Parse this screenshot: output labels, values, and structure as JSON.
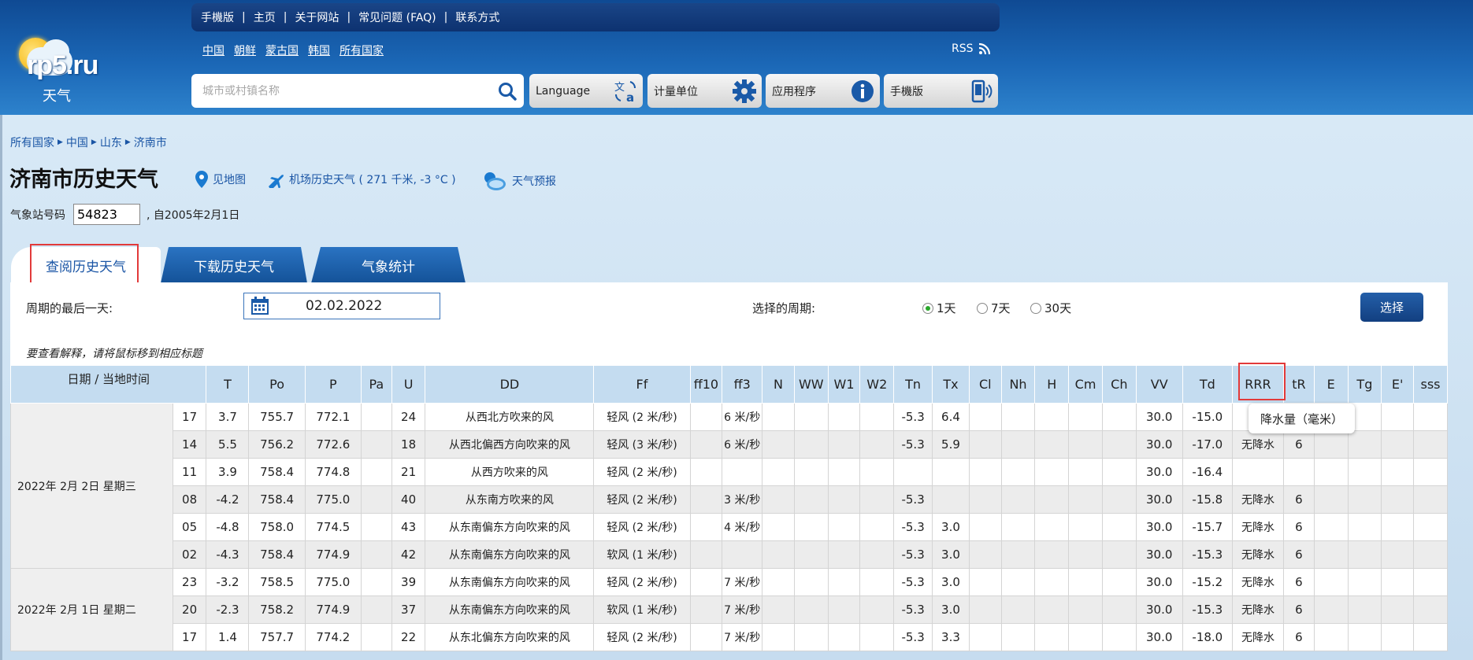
{
  "logo": {
    "brand": "rp5.ru",
    "sub": "天气"
  },
  "topnav": [
    "手機版",
    "主页",
    "关于网站",
    "常见问题 (FAQ)",
    "联系方式"
  ],
  "countries": [
    "中国",
    "朝鲜",
    "蒙古国",
    "韩国",
    "所有国家"
  ],
  "rss": "RSS",
  "search": {
    "placeholder": "城市或村镇名称"
  },
  "buttons": {
    "language": "Language",
    "units": "计量单位",
    "apps": "应用程序",
    "mobile": "手機版"
  },
  "breadcrumb": [
    "所有国家",
    "中国",
    "山东",
    "济南市"
  ],
  "page_title": "济南市历史天气",
  "title_links": {
    "map": "见地图",
    "airport": "机场历史天气 ( 271 千米, -3 °C )",
    "forecast": "天气预报"
  },
  "station": {
    "label": "气象站号码",
    "value": "54823",
    "since": ", 自2005年2月1日"
  },
  "tabs": [
    "查阅历史天气",
    "下载历史天气",
    "气象统计"
  ],
  "filter": {
    "last_day_label": "周期的最后一天:",
    "date_value": "02.02.2022",
    "period_label": "选择的周期:",
    "options": [
      "1天",
      "7天",
      "30天"
    ],
    "selected": 0,
    "submit": "选择"
  },
  "hint": "要查看解释，请将鼠标移到相应标题",
  "table": {
    "date_header": "日期  / 当地时间",
    "columns": [
      "T",
      "Po",
      "P",
      "Pa",
      "U",
      "DD",
      "Ff",
      "ff10",
      "ff3",
      "N",
      "WW",
      "W1",
      "W2",
      "Tn",
      "Tx",
      "Cl",
      "Nh",
      "H",
      "Cm",
      "Ch",
      "VV",
      "Td",
      "RRR",
      "tR",
      "E",
      "Tg",
      "E'",
      "sss"
    ],
    "groups": [
      {
        "date": "2022年 2月 2日 星期三",
        "rows": [
          {
            "time": "17",
            "T": "3.7",
            "Po": "755.7",
            "P": "772.1",
            "U": "24",
            "DD": "从西北方吹来的风",
            "Ff": "轻风 (2 米/秒)",
            "ff3": "6 米/秒",
            "Tn": "-5.3",
            "Tx": "6.4",
            "VV": "30.0",
            "Td": "-15.0",
            "RRR": "无",
            "tR": ""
          },
          {
            "time": "14",
            "T": "5.5",
            "Po": "756.2",
            "P": "772.6",
            "U": "18",
            "DD": "从西北偏西方向吹来的风",
            "Ff": "轻风 (3 米/秒)",
            "ff3": "6 米/秒",
            "Tn": "-5.3",
            "Tx": "5.9",
            "VV": "30.0",
            "Td": "-17.0",
            "RRR": "无降水",
            "tR": "6"
          },
          {
            "time": "11",
            "T": "3.9",
            "Po": "758.4",
            "P": "774.8",
            "U": "21",
            "DD": "从西方吹来的风",
            "Ff": "轻风 (2 米/秒)",
            "ff3": "",
            "Tn": "",
            "Tx": "",
            "VV": "30.0",
            "Td": "-16.4",
            "RRR": "",
            "tR": ""
          },
          {
            "time": "08",
            "T": "-4.2",
            "Po": "758.4",
            "P": "775.0",
            "U": "40",
            "DD": "从东南方吹来的风",
            "Ff": "轻风 (2 米/秒)",
            "ff3": "3 米/秒",
            "Tn": "-5.3",
            "Tx": "",
            "VV": "30.0",
            "Td": "-15.8",
            "RRR": "无降水",
            "tR": "6"
          },
          {
            "time": "05",
            "T": "-4.8",
            "Po": "758.0",
            "P": "774.5",
            "U": "43",
            "DD": "从东南偏东方向吹来的风",
            "Ff": "轻风 (2 米/秒)",
            "ff3": "4 米/秒",
            "Tn": "-5.3",
            "Tx": "3.0",
            "VV": "30.0",
            "Td": "-15.7",
            "RRR": "无降水",
            "tR": "6"
          },
          {
            "time": "02",
            "T": "-4.3",
            "Po": "758.4",
            "P": "774.9",
            "U": "42",
            "DD": "从东南偏东方向吹来的风",
            "Ff": "软风 (1 米/秒)",
            "ff3": "",
            "Tn": "-5.3",
            "Tx": "3.0",
            "VV": "30.0",
            "Td": "-15.3",
            "RRR": "无降水",
            "tR": "6"
          }
        ]
      },
      {
        "date": "2022年 2月 1日 星期二",
        "rows": [
          {
            "time": "23",
            "T": "-3.2",
            "Po": "758.5",
            "P": "775.0",
            "U": "39",
            "DD": "从东南偏东方向吹来的风",
            "Ff": "轻风 (2 米/秒)",
            "ff3": "7 米/秒",
            "Tn": "-5.3",
            "Tx": "3.0",
            "VV": "30.0",
            "Td": "-15.2",
            "RRR": "无降水",
            "tR": "6"
          },
          {
            "time": "20",
            "T": "-2.3",
            "Po": "758.2",
            "P": "774.9",
            "U": "37",
            "DD": "从东南偏东方向吹来的风",
            "Ff": "软风 (1 米/秒)",
            "ff3": "7 米/秒",
            "Tn": "-5.3",
            "Tx": "3.0",
            "VV": "30.0",
            "Td": "-15.3",
            "RRR": "无降水",
            "tR": "6"
          },
          {
            "time": "17",
            "T": "1.4",
            "Po": "757.7",
            "P": "774.2",
            "U": "22",
            "DD": "从东北偏东方向吹来的风",
            "Ff": "轻风 (2 米/秒)",
            "ff3": "7 米/秒",
            "Tn": "-5.3",
            "Tx": "3.3",
            "VV": "30.0",
            "Td": "-18.0",
            "RRR": "无降水",
            "tR": "6"
          }
        ]
      }
    ]
  },
  "tooltip": "降水量（毫米）",
  "colors": {
    "header_dark": "#0f4a93",
    "link": "#1a55a5",
    "highlight": "#e23a3a",
    "radio_on": "#29a82b"
  }
}
